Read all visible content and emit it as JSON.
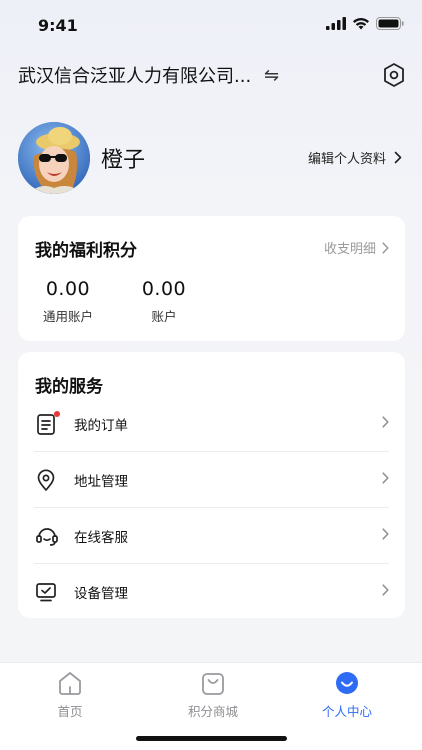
{
  "status_bar": {
    "time": "9:41"
  },
  "header": {
    "company_name": "武汉信合泛亚人力有限公司...",
    "swap_symbol": "⇋"
  },
  "profile": {
    "name": "橙子",
    "edit_label": "编辑个人资料"
  },
  "points_card": {
    "title": "我的福利积分",
    "detail_label": "收支明细",
    "accounts": [
      {
        "value": "0.00",
        "label": "通用账户"
      },
      {
        "value": "0.00",
        "label": "账户"
      }
    ]
  },
  "services_card": {
    "title": "我的服务",
    "items": [
      {
        "label": "我的订单",
        "icon": "order-list-icon",
        "badge": true
      },
      {
        "label": "地址管理",
        "icon": "location-pin-icon",
        "badge": false
      },
      {
        "label": "在线客服",
        "icon": "headset-icon",
        "badge": false
      },
      {
        "label": "设备管理",
        "icon": "monitor-icon",
        "badge": false
      }
    ]
  },
  "tab_bar": {
    "tabs": [
      {
        "label": "首页",
        "icon": "home-icon",
        "active": false
      },
      {
        "label": "积分商城",
        "icon": "shopping-bag-icon",
        "active": false
      },
      {
        "label": "个人中心",
        "icon": "smile-face-icon",
        "active": true
      }
    ]
  },
  "colors": {
    "accent": "#2e6cf6",
    "badge": "#e53935",
    "muted_text": "#9a9a9e"
  }
}
